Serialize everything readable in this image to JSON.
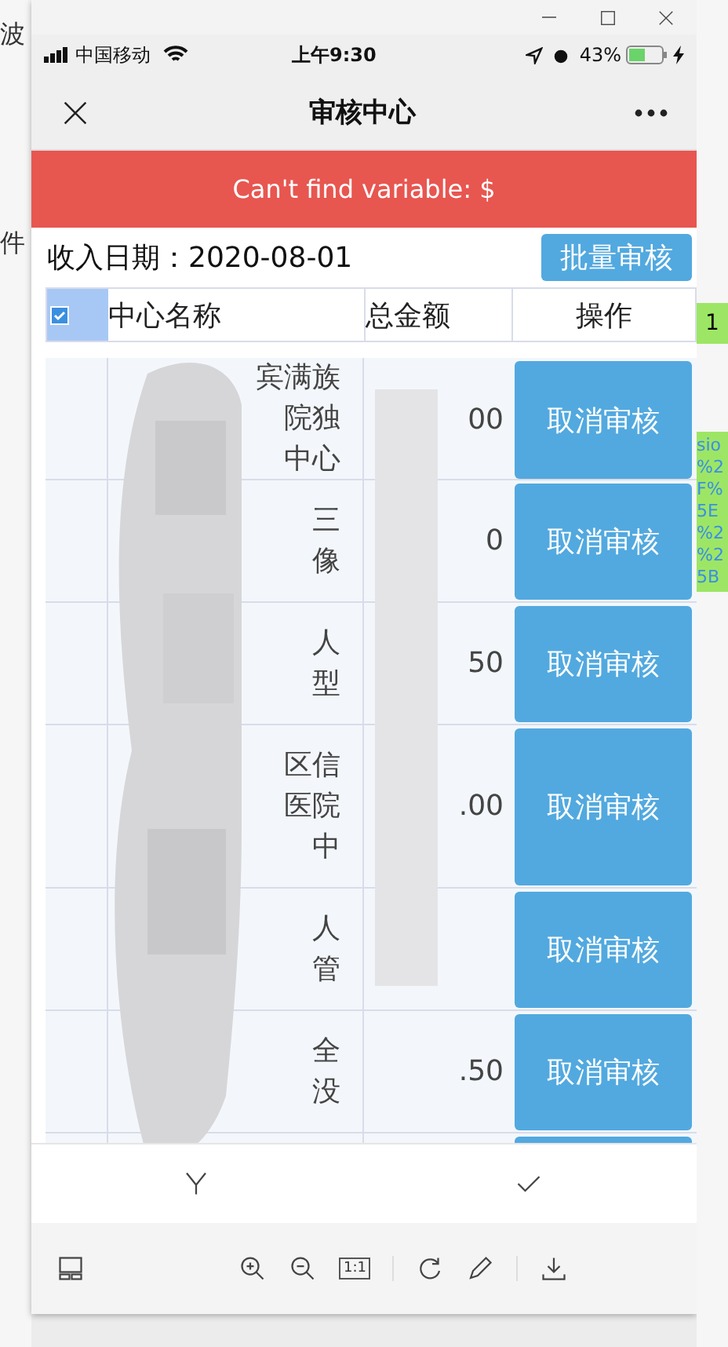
{
  "desktop": {
    "left_texts": [
      "波",
      "件"
    ],
    "right_badge": "1",
    "right_link_lines": [
      "sio",
      "%2",
      "F%",
      "5E",
      "%2",
      "%2",
      "5B"
    ]
  },
  "status_bar": {
    "carrier": "中国移动",
    "time": "上午9:30",
    "battery": "43%"
  },
  "nav": {
    "title": "审核中心"
  },
  "error_banner": "Can't find variable: $",
  "filter": {
    "label": "收入日期：",
    "value": "2020-08-01",
    "button": "批量审核"
  },
  "table": {
    "select_all": {
      "checked": true
    },
    "columns": [
      "中心名称",
      "总金额",
      "操作"
    ],
    "rows": [
      {
        "name_lines": [
          "宾满族",
          "院独",
          "中心"
        ],
        "amount": "00",
        "action": "取消审核",
        "tall": false
      },
      {
        "name_lines": [
          "三",
          "像"
        ],
        "amount": "0",
        "action": "取消审核",
        "tall": false
      },
      {
        "name_lines": [
          "人",
          "型"
        ],
        "amount": "50",
        "action": "取消审核",
        "tall": false
      },
      {
        "name_lines": [
          "区信",
          "医院",
          "中"
        ],
        "amount": ".00",
        "action": "取消审核",
        "tall": true
      },
      {
        "name_lines": [
          "人",
          "管"
        ],
        "action": "取消审核",
        "tall": false
      },
      {
        "name_lines": [
          "全",
          "没"
        ],
        "amount": ".50",
        "action": "取消审核",
        "tall": false
      },
      {
        "tall": false
      }
    ]
  },
  "viewer_toolbar": {
    "actual_size": "1:1"
  }
}
